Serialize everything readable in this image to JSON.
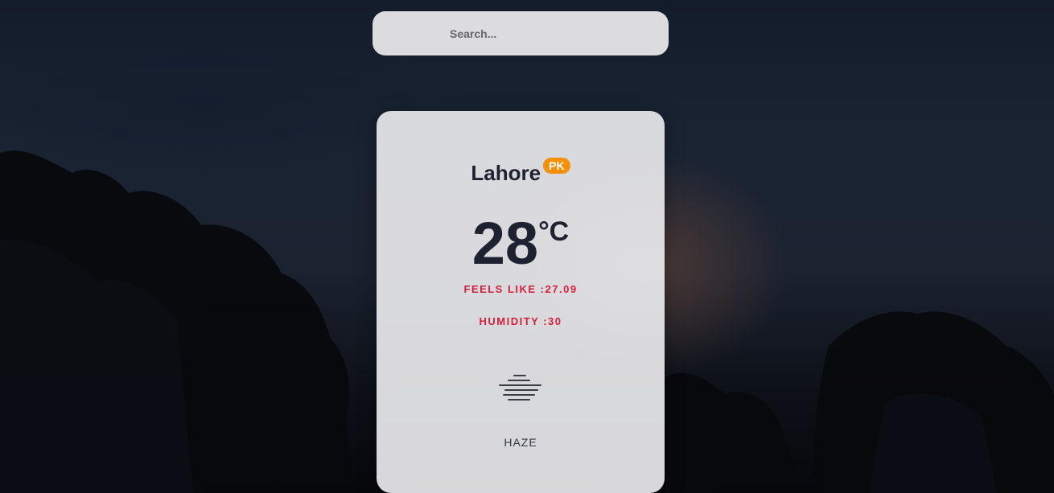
{
  "search": {
    "placeholder": "Search...",
    "value": ""
  },
  "weather": {
    "city": "Lahore",
    "country": "PK",
    "temperature": "28",
    "unit": "°C",
    "feels_like": "FEELS LIKE :27.09",
    "humidity": "HUMIDITY :30",
    "icon": "haze-icon",
    "condition": "HAZE"
  },
  "colors": {
    "badge": "#f5900a",
    "accent_text": "#d21f3c",
    "primary_text": "#1e2230",
    "card_bg": "#e8e8ec"
  }
}
